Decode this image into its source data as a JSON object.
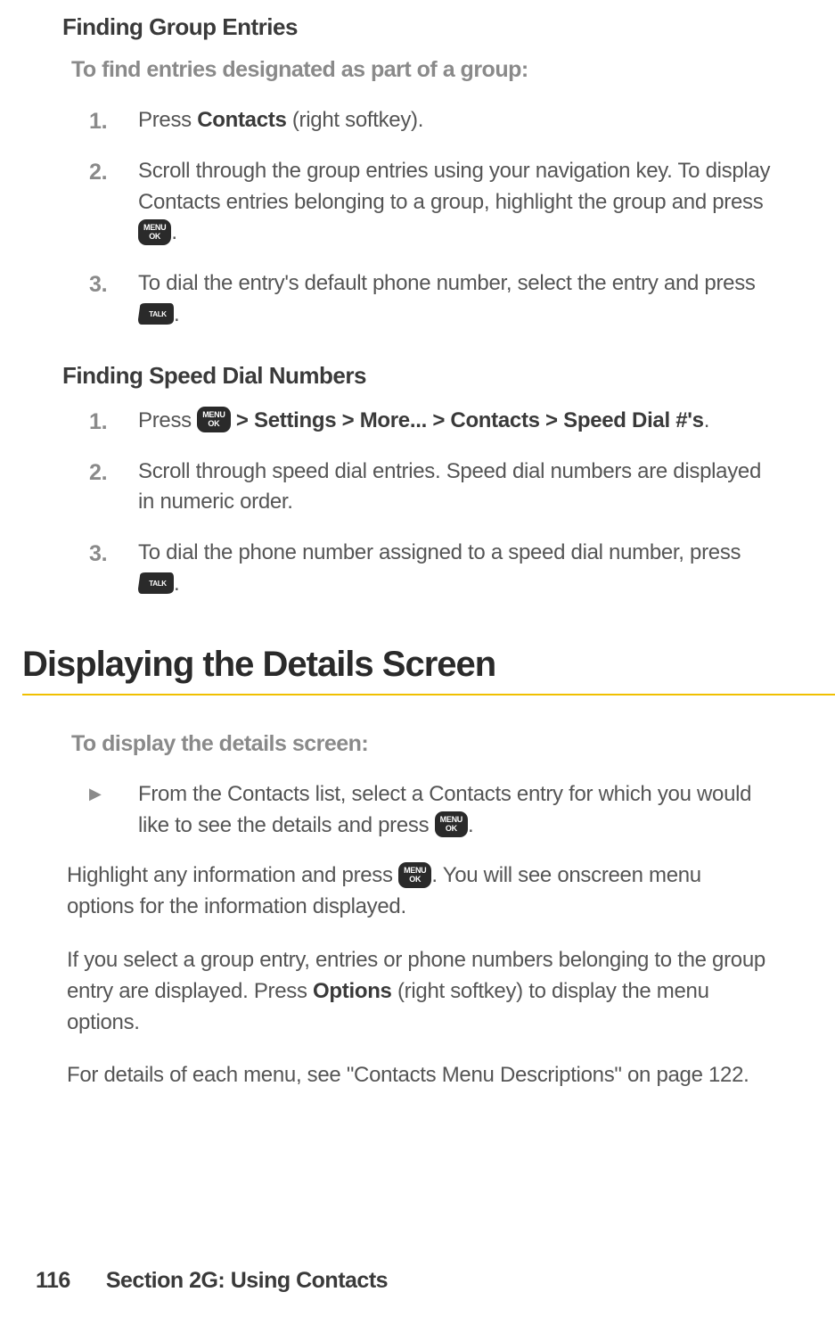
{
  "sections": {
    "findingGroup": {
      "title": "Finding Group Entries",
      "intro": "To find entries designated as part of a group:",
      "steps": [
        {
          "pre": "Press ",
          "bold1": "Contacts",
          "post1": " (right softkey)."
        },
        {
          "pre": "Scroll through the group entries using your navigation key. To display Contacts entries belonging to a group, highlight the group and press ",
          "icon1": "menu-ok",
          "post1": "."
        },
        {
          "pre": "To dial the entry's default phone number, select the entry and press ",
          "icon1": "talk",
          "post1": "."
        }
      ]
    },
    "findingSpeed": {
      "title": "Finding Speed Dial Numbers",
      "steps": [
        {
          "pre": "Press ",
          "icon1": "menu-ok",
          "mid1": " ",
          "bold1": "> Settings > More... > Contacts > Speed Dial #'s",
          "post1": "."
        },
        {
          "pre": "Scroll through speed dial entries. Speed dial numbers are displayed in numeric order."
        },
        {
          "pre": "To dial the phone number assigned to a speed dial number, press ",
          "icon1": "talk",
          "post1": "."
        }
      ]
    },
    "displaying": {
      "title": "Displaying the Details Screen",
      "intro": "To display the details screen:",
      "bullet": {
        "pre": "From the Contacts list, select a Contacts entry for which you would like to see the details and press ",
        "icon1": "menu-ok",
        "post1": "."
      },
      "para1": {
        "pre": "Highlight any information and press ",
        "icon1": "menu-ok",
        "post1": ". You will see onscreen menu options for the information displayed."
      },
      "para2": {
        "pre": "If you select a group entry, entries or phone numbers belonging to the group entry are displayed. Press ",
        "bold1": "Options",
        "post1": " (right softkey) to display the menu options."
      },
      "para3": "For details of each menu, see \"Contacts Menu Descriptions\" on page 122."
    }
  },
  "footer": {
    "page": "116",
    "section": "Section 2G: Using Contacts"
  },
  "icons": {
    "menuOk": {
      "line1": "MENU",
      "line2": "OK"
    },
    "talk": {
      "label": "TALK"
    }
  }
}
